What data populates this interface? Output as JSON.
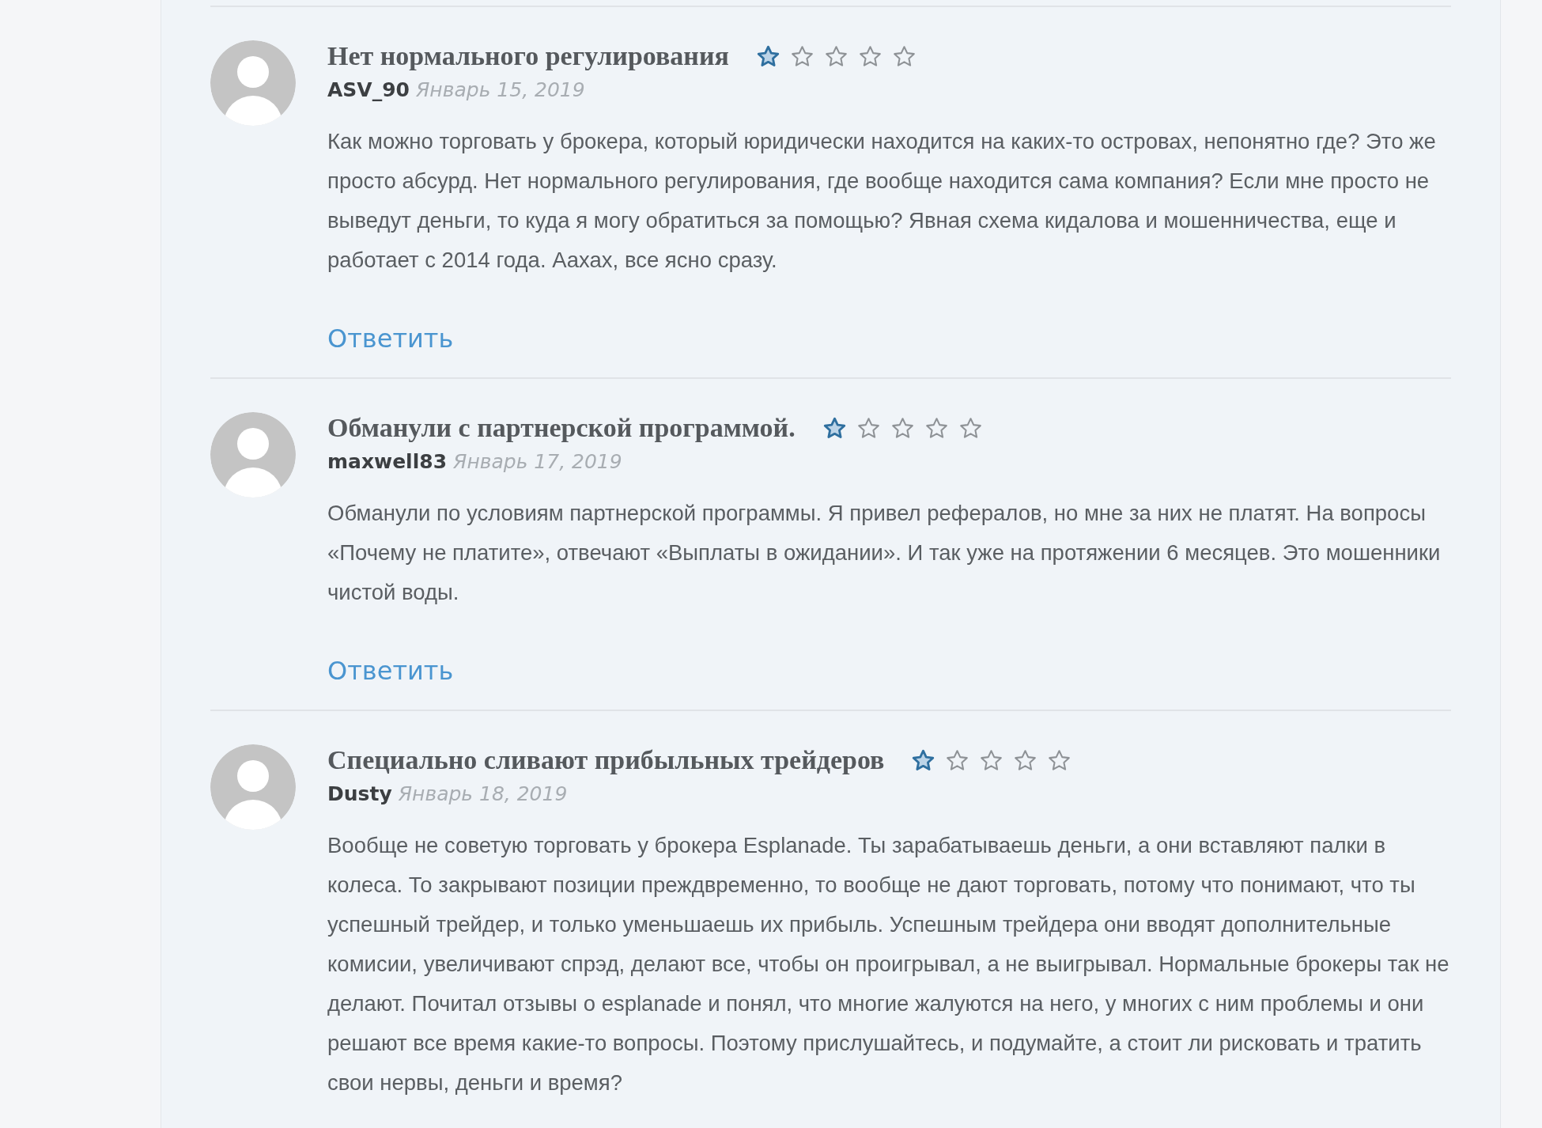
{
  "reviews": [
    {
      "title": "Нет нормального регулирования",
      "stars": 1,
      "author": "ASV_90",
      "date": "Январь 15, 2019",
      "text": "Как можно торговать у брокера, который юридически находится на каких-то островах, непонятно где? Это же просто абсурд. Нет нормального регулирования, где вообще находится сама компания? Если мне просто не выведут деньги, то куда я могу обратиться за помощью? Явная схема кидалова и мошенничества, еще и работает с 2014 года. Аахах, все ясно сразу.",
      "reply": "Ответить"
    },
    {
      "title": "Обманули с партнерской программой.",
      "stars": 1,
      "author": "maxwell83",
      "date": "Январь 17, 2019",
      "text": "Обманули по условиям партнерской программы. Я привел рефералов, но мне за них не платят. На вопросы «Почему не платите», отвечают «Выплаты в ожидании». И так уже на протяжении 6 месяцев. Это мошенники чистой воды.",
      "reply": "Ответить"
    },
    {
      "title": "Специально сливают прибыльных трейдеров",
      "stars": 1,
      "author": "Dusty",
      "date": "Январь 18, 2019",
      "text": "Вообще не советую торговать у брокера Esplanade. Ты зарабатываешь деньги, а они вставляют палки в колеса. То закрывают позиции преждвременно, то вообще не дают торговать, потому что понимают, что ты успешный трейдер, и только уменьшаешь их прибыль. Успешным трейдера они вводят дополнительные комисии, увеличивают спрэд, делают все, чтобы он проигрывал, а не выигрывал. Нормальные брокеры так не делают. Почитал отзывы о esplanade и понял, что многие жалуются на него, у многих с ним проблемы и они решают все время какие-то вопросы. Поэтому прислушайтесь, и подумайте, а стоит ли рисковать и тратить свои нервы, деньги и время?"
    }
  ]
}
